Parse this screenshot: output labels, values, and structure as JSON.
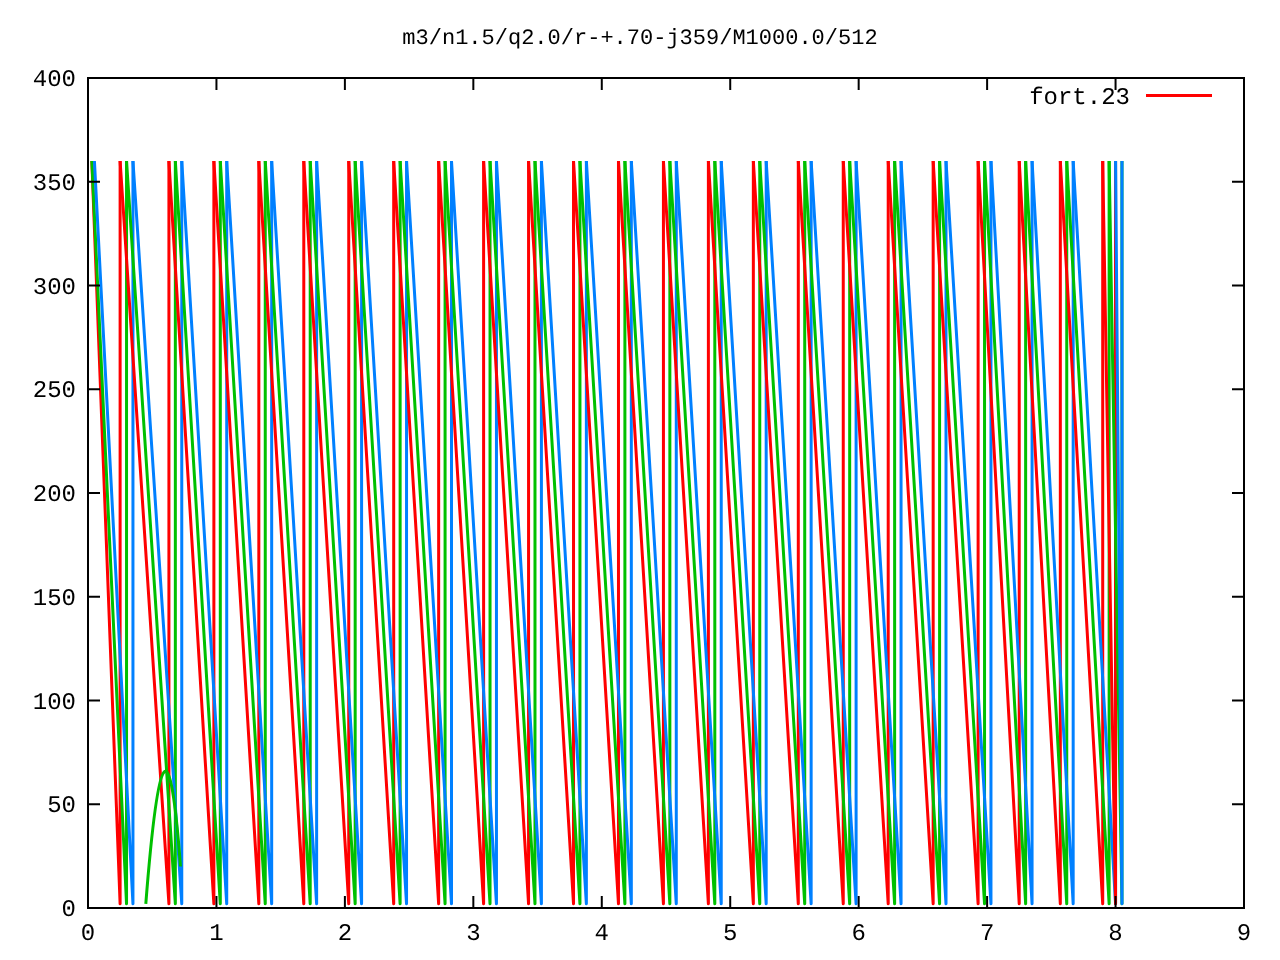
{
  "title": "m3/n1.5/q2.0/r-+.70-j359/M1000.0/512",
  "legend": [
    {
      "label": "fort.23",
      "color": "#ff0000"
    }
  ],
  "x_axis": {
    "ticks": [
      "0",
      "1",
      "2",
      "3",
      "4",
      "5",
      "6",
      "7",
      "8",
      "9"
    ]
  },
  "y_axis": {
    "ticks": [
      "400",
      "350",
      "300",
      "250",
      "200",
      "150",
      "100",
      "50",
      "0"
    ]
  }
}
